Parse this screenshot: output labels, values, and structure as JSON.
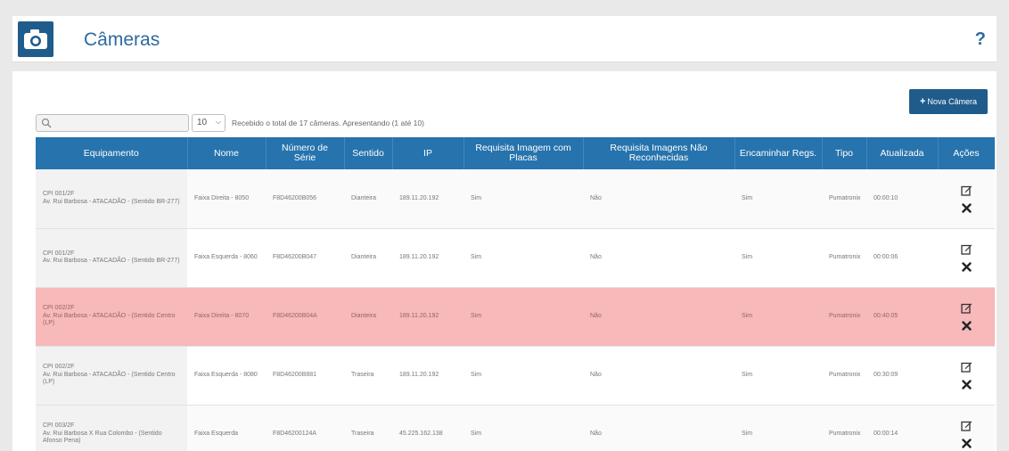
{
  "header": {
    "title": "Câmeras",
    "help": "?"
  },
  "toolbar": {
    "new_camera": "Nova Câmera",
    "search_placeholder": "",
    "per_page": "10",
    "info": "Recebido o total de 17 câmeras. Apresentando (1 até 10)"
  },
  "table": {
    "columns": [
      "Equipamento",
      "Nome",
      "Número de Série",
      "Sentido",
      "IP",
      "Requisita Imagem com Placas",
      "Requisita Imagens Não Reconhecidas",
      "Encaminhar Regs.",
      "Tipo",
      "Atualizada",
      "Ações"
    ],
    "rows": [
      {
        "equip1": "CPI 001/2F",
        "equip2": "Av. Rui Barbosa - ATACADÃO - (Sentido BR-277)",
        "nome": "Faixa Direita - 8050",
        "serie": "F8D46200B056",
        "sentido": "Dianteira",
        "ip": "189.11.20.192",
        "placas": "Sim",
        "nao_rec": "Não",
        "encaminhar": "Sim",
        "tipo": "Pumatronix",
        "atualizada": "00:00:10",
        "highlight": false
      },
      {
        "equip1": "CPI 001/2F",
        "equip2": "Av. Rui Barbosa - ATACADÃO - (Sentido BR-277)",
        "nome": "Faixa Esquerda - 8060",
        "serie": "F8D46200B047",
        "sentido": "Dianteira",
        "ip": "189.11.20.192",
        "placas": "Sim",
        "nao_rec": "Não",
        "encaminhar": "Sim",
        "tipo": "Pumatronix",
        "atualizada": "00:00:06",
        "highlight": false
      },
      {
        "equip1": "CPI 002/2F",
        "equip2": "Av. Rui Barbosa - ATACADÃO - (Sentido Centro (LP)",
        "nome": "Faixa Direita - 8070",
        "serie": "F8D46200B04A",
        "sentido": "Dianteira",
        "ip": "189.11.20.192",
        "placas": "Sim",
        "nao_rec": "Não",
        "encaminhar": "Sim",
        "tipo": "Pumatronix",
        "atualizada": "00:40:05",
        "highlight": true
      },
      {
        "equip1": "CPI 002/2F",
        "equip2": "Av. Rui Barbosa - ATACADÃO - (Sentido Centro (LP)",
        "nome": "Faixa Esquerda - 8080",
        "serie": "F8D46200B881",
        "sentido": "Traseira",
        "ip": "189.11.20.192",
        "placas": "Sim",
        "nao_rec": "Não",
        "encaminhar": "Sim",
        "tipo": "Pumatronix",
        "atualizada": "00:30:09",
        "highlight": false
      },
      {
        "equip1": "CPI 003/2F",
        "equip2": "Av. Rui Barbosa X Rua Colombo - (Sentido Afonso Pena)",
        "nome": "Faixa Esquerda",
        "serie": "F8D46200124A",
        "sentido": "Traseira",
        "ip": "45.225.162.138",
        "placas": "Sim",
        "nao_rec": "Não",
        "encaminhar": "Sim",
        "tipo": "Pumatronix",
        "atualizada": "00:00:14",
        "highlight": false
      }
    ]
  },
  "icons": {
    "camera": "camera-icon",
    "search": "search-icon",
    "edit": "edit-icon",
    "delete": "delete-icon"
  },
  "colors": {
    "brand": "#1f5c8b",
    "table_header": "#2673ad",
    "highlight_row": "#f7b9ba",
    "title": "#2d6aa0"
  }
}
